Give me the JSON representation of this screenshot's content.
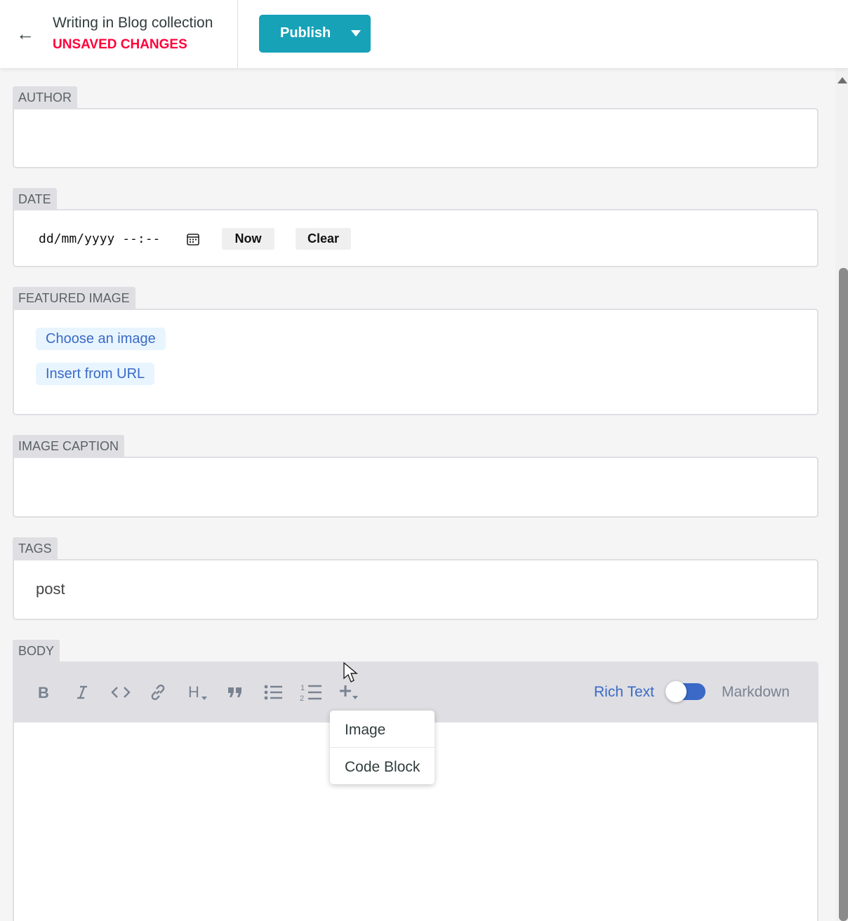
{
  "header": {
    "back_icon": "arrow-left-icon",
    "title": "Writing in Blog collection",
    "status": "UNSAVED CHANGES",
    "publish_label": "Publish",
    "status_color": "#ff003b",
    "accent_color": "#17a2b8"
  },
  "fields": {
    "author": {
      "label": "AUTHOR",
      "value": ""
    },
    "date": {
      "label": "DATE",
      "placeholder": "dd/mm/yyyy --:--",
      "now_label": "Now",
      "clear_label": "Clear"
    },
    "featured_image": {
      "label": "FEATURED IMAGE",
      "choose_label": "Choose an image",
      "url_label": "Insert from URL"
    },
    "image_caption": {
      "label": "IMAGE CAPTION",
      "value": ""
    },
    "tags": {
      "label": "TAGS",
      "value": "post"
    },
    "body": {
      "label": "BODY",
      "toolbar": [
        "bold-icon",
        "italic-icon",
        "code-icon",
        "link-icon",
        "heading-icon",
        "quote-icon",
        "bulleted-list-icon",
        "numbered-list-icon",
        "add-component-icon"
      ],
      "mode_rich": "Rich Text",
      "mode_markdown": "Markdown",
      "active_mode": "Rich Text",
      "insert_menu": [
        "Image",
        "Code Block"
      ]
    }
  }
}
